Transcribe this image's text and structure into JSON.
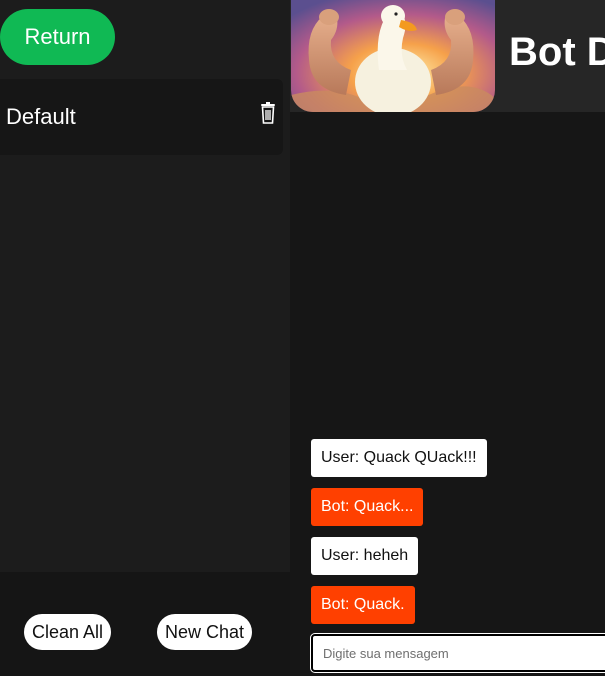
{
  "sidebar": {
    "return_label": "Return",
    "chats": [
      {
        "label": "Default"
      }
    ],
    "clean_all_label": "Clean All",
    "new_chat_label": "New Chat"
  },
  "header": {
    "title": "Bot D"
  },
  "messages": [
    {
      "role": "user",
      "text": "User: Quack QUack!!!"
    },
    {
      "role": "bot",
      "text": "Bot: Quack..."
    },
    {
      "role": "user",
      "text": "User: heheh"
    },
    {
      "role": "bot",
      "text": "Bot: Quack."
    }
  ],
  "composer": {
    "placeholder": "Digite sua mensagem",
    "value": ""
  },
  "colors": {
    "accent_green": "#10b954",
    "bot_bubble": "#ff4000",
    "user_bubble": "#ffffff"
  },
  "icons": {
    "delete": "trash-icon"
  }
}
